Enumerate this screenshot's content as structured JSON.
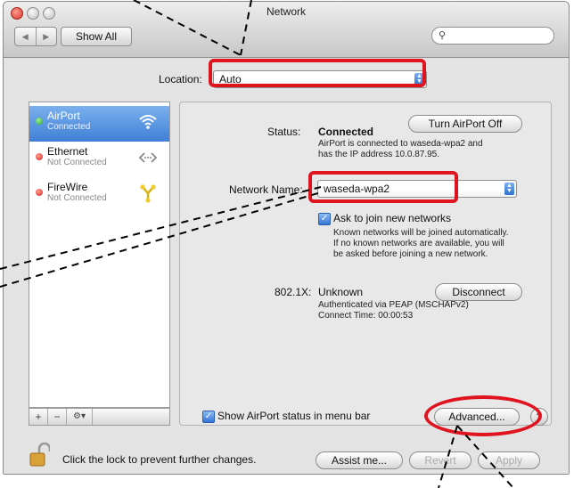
{
  "window": {
    "title": "Network"
  },
  "toolbar": {
    "back_glyph": "◀",
    "forward_glyph": "▶",
    "show_all_label": "Show All",
    "search_placeholder": "",
    "search_icon": "magnifying-glass-icon"
  },
  "location": {
    "label": "Location:",
    "value": "Auto"
  },
  "services": [
    {
      "name": "AirPort",
      "status": "Connected",
      "selected": true,
      "icon": "wifi-icon"
    },
    {
      "name": "Ethernet",
      "status": "Not Connected",
      "selected": false,
      "icon": "ethernet-icon"
    },
    {
      "name": "FireWire",
      "status": "Not Connected",
      "selected": false,
      "icon": "firewire-icon"
    }
  ],
  "sidebar_tools": {
    "add": "+",
    "remove": "−",
    "gear": "⚙▾"
  },
  "detail": {
    "status_label": "Status:",
    "status_value": "Connected",
    "turn_off_label": "Turn AirPort Off",
    "status_desc_line1": "AirPort is connected to waseda-wpa2 and",
    "status_desc_line2": "has the IP address 10.0.87.95.",
    "network_name_label": "Network Name:",
    "network_name_value": "waseda-wpa2",
    "ask_join_label": "Ask to join new networks",
    "ask_join_desc_line1": "Known networks will be joined automatically.",
    "ask_join_desc_line2": "If no known networks are available, you will",
    "ask_join_desc_line3": "be asked before joining a new network.",
    "dot1x_label": "802.1X:",
    "dot1x_value": "Unknown",
    "disconnect_label": "Disconnect",
    "auth_line1": "Authenticated via PEAP (MSCHAPv2)",
    "auth_line2": "Connect Time: 00:00:53",
    "show_status_label": "Show AirPort status in menu bar",
    "advanced_label": "Advanced...",
    "help_label": "?"
  },
  "footer": {
    "lock_text": "Click the lock to prevent further changes.",
    "assist_label": "Assist me...",
    "revert_label": "Revert",
    "apply_label": "Apply"
  },
  "annotation_color": "#e0141e"
}
